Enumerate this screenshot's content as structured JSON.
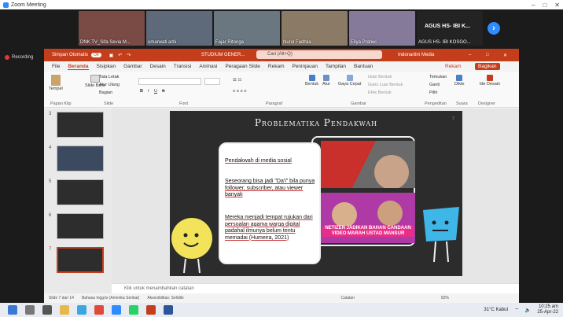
{
  "zoom": {
    "title": "Zoom Meeting"
  },
  "gallery": {
    "participants": [
      {
        "name": "DNK TV_Sifa Sevia M...",
        "color": "#7a4a45"
      },
      {
        "name": "umarwati arbi",
        "color": "#5e6a7a"
      },
      {
        "name": "Fajar Ritonga",
        "color": "#6a7780"
      },
      {
        "name": "Nurul Fadhila",
        "color": "#8a7a66"
      },
      {
        "name": "Eliya Pratiwi",
        "color": "#857a9a"
      }
    ],
    "overflow_name": "AGUS HS- IBI K...",
    "overflow_label": "AGUS HS- IBI KOSGO..."
  },
  "recording": {
    "label": "Recording"
  },
  "ppt": {
    "autosave": "Simpan Otomatis",
    "autosave_state": "Off",
    "doc_title": "STUDIUM GENER...",
    "search": "Cari (Alt+Q)",
    "account": "Indonartim Media",
    "tabs": [
      "File",
      "Beranda",
      "Sisipkan",
      "Gambar",
      "Desain",
      "Transisi",
      "Animasi",
      "Peragaan Slide",
      "Rekam",
      "Peninjauan",
      "Tampilan",
      "Bantuan"
    ],
    "record_btn": "Rekam",
    "share_btn": "Bagikan",
    "ribbon": {
      "paste": "Tempel",
      "new_slide": "Slide Baru",
      "layout": "Tata Letak",
      "reset": "Atur Ulang",
      "section": "Bagian",
      "shapes": "Bentuk",
      "arrange": "Atur",
      "quick_styles": "Gaya Cepat",
      "fill": "Isian Bentuk",
      "outline": "Garis Luar Bentuk",
      "effects": "Efek Bentuk",
      "find": "Temukan",
      "replace": "Ganti",
      "select": "Pilih",
      "dictate": "Dikte",
      "designer": "Ide Desain",
      "groups": [
        "Papan Klip",
        "Slide",
        "Font",
        "Paragraf",
        "Gambar",
        "Pengeditan",
        "Suara",
        "Designer"
      ]
    },
    "thumb_numbers": [
      "3",
      "4",
      "5",
      "6",
      "7"
    ],
    "slide": {
      "title": "Problematika Pendakwah",
      "number": "7",
      "bullets": [
        "Pendakwah di media sosial",
        "Seseorang bisa jadi \"Da'i\" bila punya follower, subscriber, atau viewer banyak",
        "Mereka menjadi tempat rujukan dari persoalan agama warga digital padahal ilmunya belum tentu memadai (Humeira, 2021)"
      ],
      "caption": "NETIZEN JADIKAN BAHAN CANDAAN VIDEO MARAH USTAD MANSUR"
    },
    "notes_placeholder": "Klik untuk menambahkan catatan",
    "status": {
      "slide": "Slide 7 dari 14",
      "lang": "Bahasa Inggris (Amerika Serikat)",
      "access": "Aksesibilitas: Selidiki",
      "notes": "Catatan",
      "zoom": "83%"
    }
  },
  "taskbar": {
    "weather": "31°C Kabut",
    "time": "10:25 am",
    "date": "25-Apr-22"
  }
}
